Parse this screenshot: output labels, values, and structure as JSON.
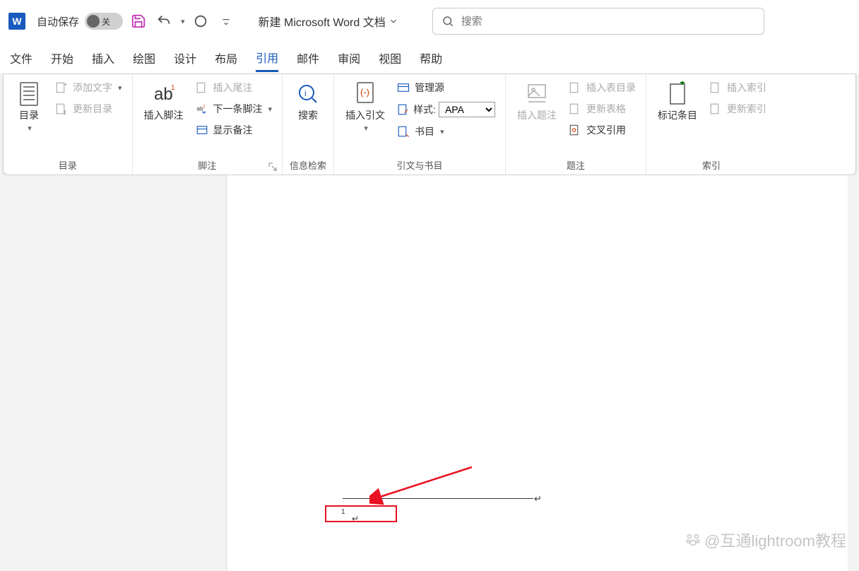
{
  "titlebar": {
    "autosave_label": "自动保存",
    "autosave_state": "关",
    "doc_title": "新建 Microsoft Word 文档"
  },
  "search": {
    "placeholder": "搜索"
  },
  "tabs": [
    "文件",
    "开始",
    "插入",
    "绘图",
    "设计",
    "布局",
    "引用",
    "邮件",
    "审阅",
    "视图",
    "帮助"
  ],
  "active_tab": "引用",
  "ribbon": {
    "toc": {
      "label": "目录",
      "main": "目录",
      "add_text": "添加文字",
      "update": "更新目录"
    },
    "footnotes": {
      "label": "脚注",
      "insert": "插入脚注",
      "endnote": "插入尾注",
      "next": "下一条脚注",
      "show": "显示备注"
    },
    "search_group": {
      "label": "信息检索",
      "search": "搜索"
    },
    "citations": {
      "label": "引文与书目",
      "insert": "插入引文",
      "manage": "管理源",
      "style_label": "样式:",
      "style_value": "APA",
      "biblio": "书目"
    },
    "captions": {
      "label": "题注",
      "insert": "插入题注",
      "toc_figures": "插入表目录",
      "update_table": "更新表格",
      "crossref": "交叉引用"
    },
    "index": {
      "label": "索引",
      "mark": "标记条目",
      "insert": "插入索引",
      "update": "更新索引"
    }
  },
  "footnote": {
    "number": "1"
  },
  "watermark": "@互通lightroom教程"
}
